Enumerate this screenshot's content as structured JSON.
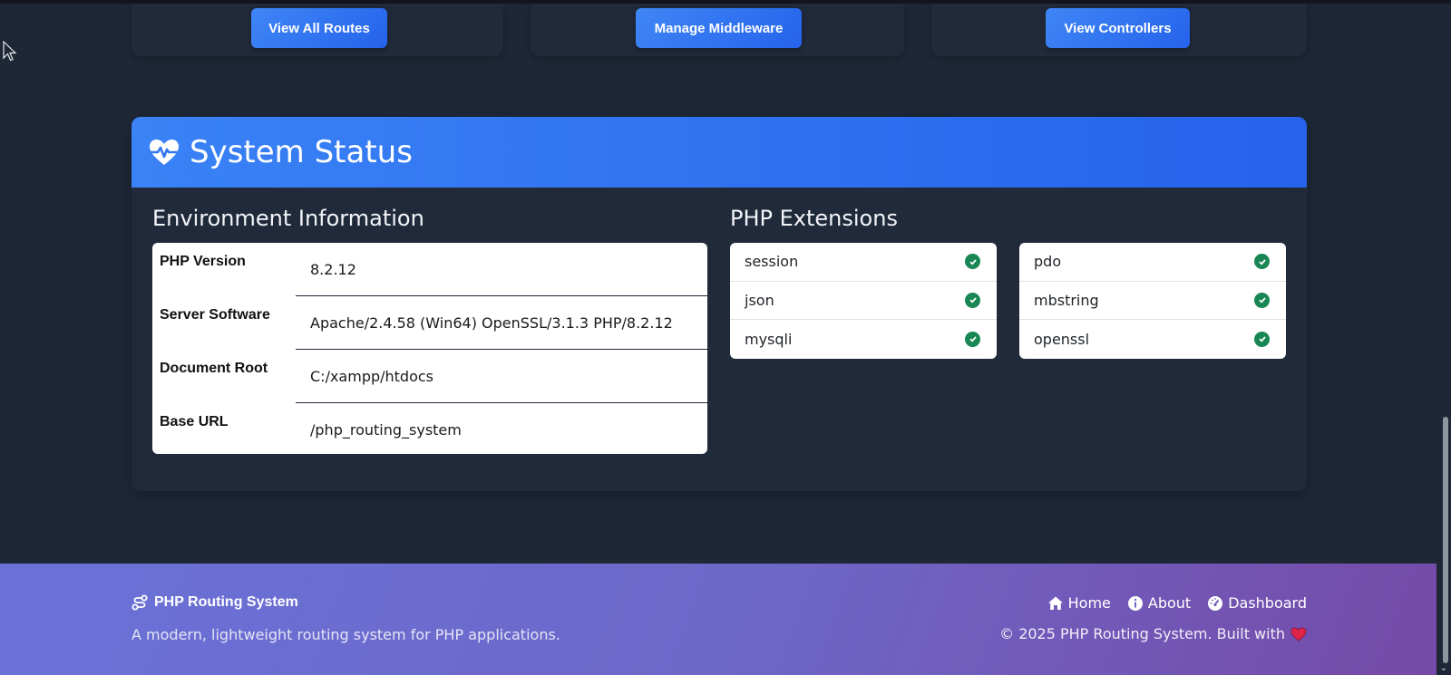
{
  "top_actions": {
    "view_routes": "View All Routes",
    "manage_middleware": "Manage Middleware",
    "view_controllers": "View Controllers"
  },
  "status": {
    "title": "System Status",
    "icon": "heart-pulse-icon",
    "environment": {
      "heading": "Environment Information",
      "rows": [
        {
          "label": "PHP Version",
          "value": "8.2.12"
        },
        {
          "label": "Server Software",
          "value": "Apache/2.4.58 (Win64) OpenSSL/3.1.3 PHP/8.2.12"
        },
        {
          "label": "Document Root",
          "value": "C:/xampp/htdocs"
        },
        {
          "label": "Base URL",
          "value": "/php_routing_system"
        }
      ]
    },
    "extensions": {
      "heading": "PHP Extensions",
      "left": [
        "session",
        "json",
        "mysqli"
      ],
      "right": [
        "pdo",
        "mbstring",
        "openssl"
      ],
      "status_icon": "check-circle-icon"
    }
  },
  "footer": {
    "brand": "PHP Routing System",
    "tagline": "A modern, lightweight routing system for PHP applications.",
    "nav": {
      "home": "Home",
      "about": "About",
      "dashboard": "Dashboard"
    },
    "copyright": "© 2025 PHP Routing System. Built with"
  },
  "colors": {
    "background": "#1e2736",
    "card": "#202a3a",
    "primary": "#2563eb",
    "success": "#198754",
    "heart": "#e0254a"
  }
}
